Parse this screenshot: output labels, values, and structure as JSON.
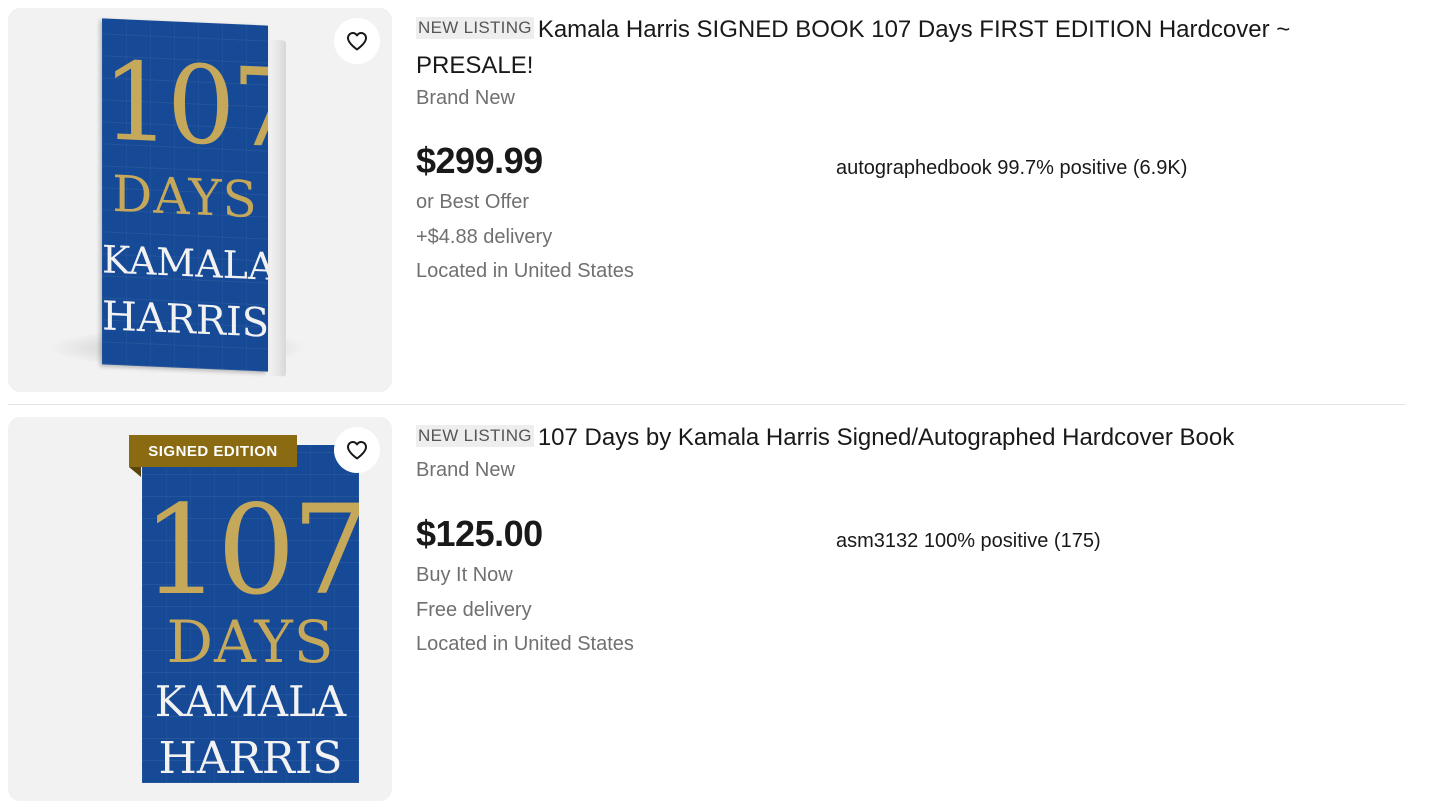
{
  "listings": [
    {
      "badge": "NEW LISTING",
      "title": "Kamala Harris SIGNED BOOK 107 Days FIRST EDITION Hardcover ~ PRESALE!",
      "condition": "Brand New",
      "price": "$299.99",
      "purchase_option": "or Best Offer",
      "delivery": "+$4.88 delivery",
      "location": "Located in United States",
      "seller": "autographedbook 99.7% positive (6.9K)",
      "cover": {
        "number": "107",
        "word": "DAYS",
        "first_name": "KAMALA",
        "last_name": "HARRIS"
      },
      "watch_icon": "heart-icon"
    },
    {
      "badge": "NEW LISTING",
      "title": "107 Days by Kamala Harris Signed/Autographed Hardcover Book",
      "condition": "Brand New",
      "price": "$125.00",
      "purchase_option": "Buy It Now",
      "delivery": "Free delivery",
      "location": "Located in United States",
      "seller": "asm3132 100% positive (175)",
      "cover": {
        "banner": "SIGNED EDITION",
        "number": "107",
        "word": "DAYS",
        "first_name": "KAMALA",
        "last_name": "HARRIS"
      },
      "watch_icon": "heart-icon"
    }
  ],
  "colors": {
    "cover_blue": "#164a96",
    "cover_gold": "#c5a85a",
    "banner_gold": "#8b6b12",
    "secondary_text": "#707070",
    "badge_bg": "#eeeeee"
  }
}
